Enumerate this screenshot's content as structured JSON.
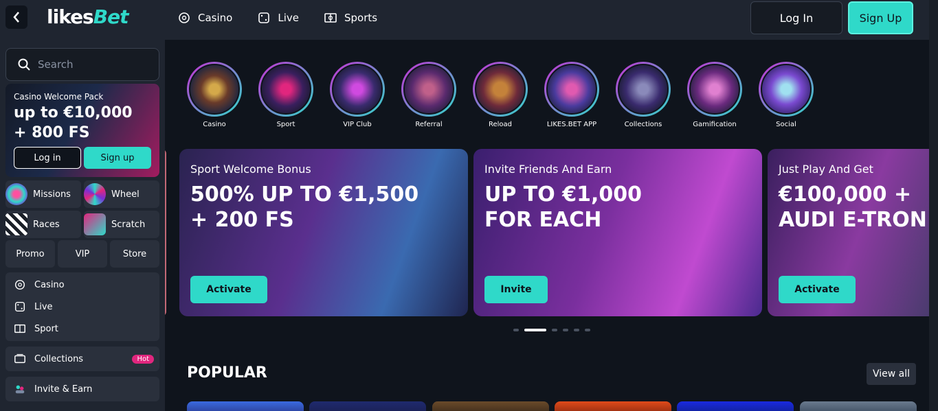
{
  "header": {
    "logo_part1": "likes",
    "logo_part2": "Bet",
    "nav": [
      {
        "label": "Casino",
        "icon": "casino-icon"
      },
      {
        "label": "Live",
        "icon": "dice-icon"
      },
      {
        "label": "Sports",
        "icon": "sports-icon"
      }
    ],
    "login_label": "Log In",
    "signup_label": "Sign Up"
  },
  "sidebar": {
    "search_placeholder": "Search",
    "welcome": {
      "title": "Casino Welcome Pack",
      "offer_line1": "up to €10,000",
      "offer_line2": "+ 800 FS",
      "login_label": "Log in",
      "signup_label": "Sign up"
    },
    "tiles": [
      {
        "label": "Missions",
        "icon": "missions-icon"
      },
      {
        "label": "Wheel",
        "icon": "wheel-icon"
      },
      {
        "label": "Races",
        "icon": "races-icon"
      },
      {
        "label": "Scratch",
        "icon": "scratch-icon"
      }
    ],
    "small_tiles": [
      "Promo",
      "VIP",
      "Store"
    ],
    "menu": [
      {
        "label": "Casino",
        "icon": "casino-icon"
      },
      {
        "label": "Live",
        "icon": "dice-icon"
      },
      {
        "label": "Sport",
        "icon": "sports-icon"
      }
    ],
    "collections": {
      "label": "Collections",
      "badge": "Hot"
    },
    "invite": {
      "label": "Invite & Earn"
    }
  },
  "stories": [
    "Casino",
    "Sport",
    "VIP Club",
    "Referral",
    "Reload",
    "LIKES.BET APP",
    "Collections",
    "Gamification",
    "Social"
  ],
  "banners": [
    {
      "sub": "Sport Welcome Bonus",
      "line1": "500% UP TO €1,500",
      "line2": "+ 200 FS",
      "button": "Activate"
    },
    {
      "sub": "Invite Friends And Earn",
      "line1": "UP TO €1,000",
      "line2": "FOR EACH",
      "button": "Invite"
    },
    {
      "sub": "Just Play And Get",
      "line1": "€100,000 +",
      "line2": "AUDI E-TRON",
      "button": "Activate"
    }
  ],
  "popular": {
    "title": "POPULAR",
    "view_all": "View all"
  },
  "colors": {
    "accent": "#2fd9c9",
    "hot": "#e1267e",
    "bg": "#0f141c",
    "panel": "#1f2530"
  }
}
